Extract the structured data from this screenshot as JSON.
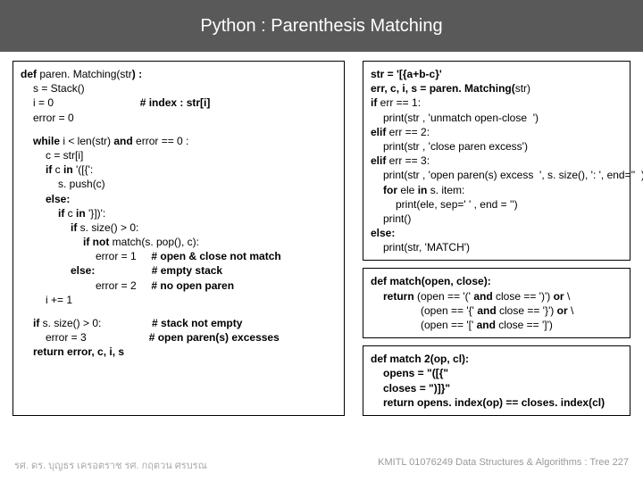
{
  "header": {
    "title": "Python : Parenthesis Matching"
  },
  "left": {
    "l1a": "def ",
    "l1b": "paren. Matching(str",
    "l1c": ") :",
    "l2": "s = Stack()",
    "l3a": "i = 0",
    "l3b": "# index : str[i]",
    "l4": "error = 0",
    "l5a": "while ",
    "l5b": "i < len(str) ",
    "l5c": "and ",
    "l5d": "error == 0 :",
    "l6": "c = str[i]",
    "l7a": "if ",
    "l7b": "c ",
    "l7c": "in ",
    "l7d": "'([{':",
    "l8": "s. push(c)",
    "l9": "else:",
    "l10a": "if ",
    "l10b": "c ",
    "l10c": "in ",
    "l10d": "'}])':",
    "l11a": "if ",
    "l11b": "s. size() > 0:",
    "l12a": "if not ",
    "l12b": "match(s. pop(), c):",
    "l13a": "error = 1",
    "l13b": "# open & close not match",
    "l14a": "else:",
    "l14b": "# empty stack",
    "l15a": "error = 2",
    "l15b": "# no open paren",
    "l16": "i += 1",
    "l17a": "if ",
    "l17b": "s. size() > 0:",
    "l17c": "# stack not empty",
    "l18a": "error = 3",
    "l18b": "# open paren(s) excesses",
    "l19a": "return ",
    "l19b": "error, c, i, s"
  },
  "r1": {
    "l1": "str = '[{a+b-c}'",
    "l2a": "err, c, i, s = paren. Matching(",
    "l2b": "str)",
    "l3a": "if ",
    "l3b": "err == 1:",
    "l4": "print(str , 'unmatch open-close  ')",
    "l5a": "elif ",
    "l5b": "err == 2:",
    "l6": "print(str , 'close paren excess')",
    "l7a": "elif ",
    "l7b": "err == 3:",
    "l8": "print(str , 'open paren(s) excess  ', s. size(), ': ', end=''  )",
    "l9a": "for ",
    "l9b": "ele ",
    "l9c": "in ",
    "l9d": "s. item:",
    "l10": "print(ele, sep=' ' , end = '')",
    "l11": "print()",
    "l12": "else:",
    "l13": "print(str, 'MATCH')"
  },
  "r2": {
    "l1a": "def ",
    "l1b": "match(open, close):",
    "l2a": "return ",
    "l2b": "(open == '(' ",
    "l2c": "and ",
    "l2d": "close == ')') ",
    "l2e": "or ",
    "l2f": "\\",
    "l3a": "(open == '{' ",
    "l3b": "and ",
    "l3c": "close == '}') ",
    "l3d": "or ",
    "l3e": "\\",
    "l4a": "(open == '[' ",
    "l4b": "and ",
    "l4c": "close == ']')"
  },
  "r3": {
    "l1a": "def ",
    "l1b": "match 2(op, cl):",
    "l2": "opens = \"([{\"",
    "l3": "closes = \")]}\"",
    "l4a": "return ",
    "l4b": "opens. ",
    "l4c": "index(op",
    "l4d": ") == closes. ",
    "l4e": "index(cl",
    "l4f": ")"
  },
  "footer": {
    "left": "รศ. ดร. บุญธร     เครอตราช       รศ. กฤตวน  ศรบรณ",
    "right": "KMITL    01076249 Data Structures & Algorithms : Tree 227"
  }
}
